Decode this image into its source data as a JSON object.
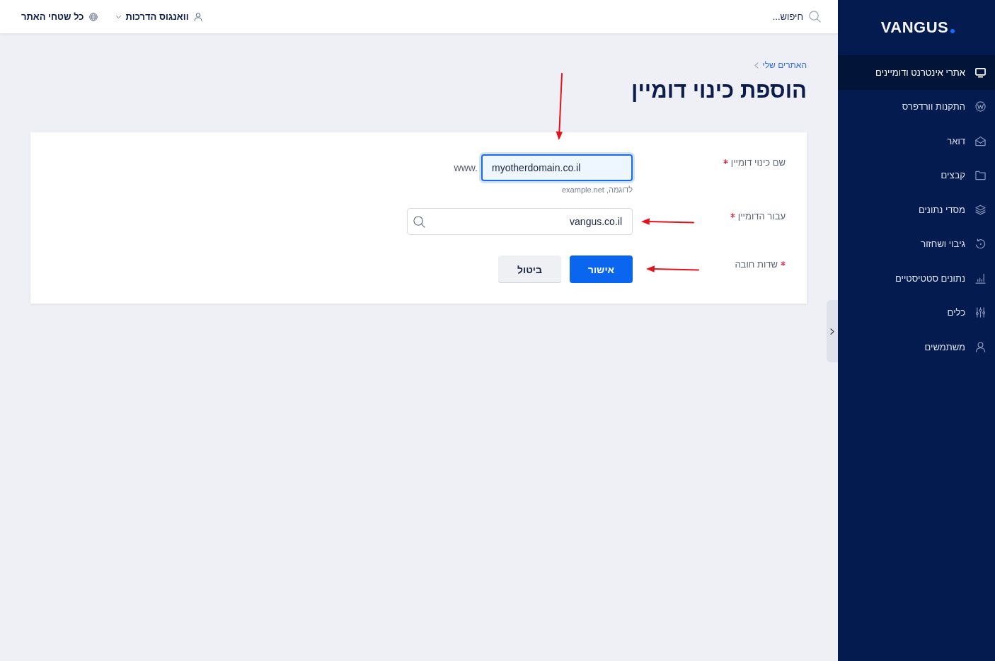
{
  "sidebar": {
    "logo": "VANGUS",
    "items": [
      {
        "label": "אתרי אינטרנט ודומיינים",
        "selected": true
      },
      {
        "label": "התקנות וורדפרס",
        "selected": false
      },
      {
        "label": "דואר",
        "selected": false
      },
      {
        "label": "קבצים",
        "selected": false
      },
      {
        "label": "מסדי נתונים",
        "selected": false
      },
      {
        "label": "גיבוי ושחזור",
        "selected": false
      },
      {
        "label": "נתונים סטטיסטיים",
        "selected": false
      },
      {
        "label": "כלים",
        "selected": false
      },
      {
        "label": "משתמשים",
        "selected": false
      }
    ]
  },
  "top_bar": {
    "search": {
      "placeholder": "חיפוש..."
    },
    "user_menu": {
      "label": "וואנגוס הדרכות"
    },
    "site_selector": {
      "label": "כל שטחי האתר"
    }
  },
  "breadcrumb": [
    {
      "label": "האתרים שלי"
    }
  ],
  "page_title": "הוספת כינוי דומיין",
  "form": {
    "fields": [
      {
        "kind": "text",
        "label": "שם כינוי דומיין",
        "required": true,
        "prefix": "www.",
        "value": "myotherdomain.co.il",
        "hint": "לדוגמה, example.net",
        "focused": true,
        "annotation": {
          "kind": "downarrow"
        }
      },
      {
        "kind": "search",
        "label": "עבור הדומיין",
        "required": true,
        "value": "vangus.co.il",
        "focused": false,
        "annotation": {
          "kind": "leftarrow"
        }
      }
    ],
    "required_note": "שדות חובה",
    "buttons": [
      {
        "kind": "primary",
        "label": "אישור"
      },
      {
        "kind": "secondary",
        "label": "ביטול"
      }
    ],
    "buttons_annotation": {
      "kind": "leftarrow"
    }
  }
}
